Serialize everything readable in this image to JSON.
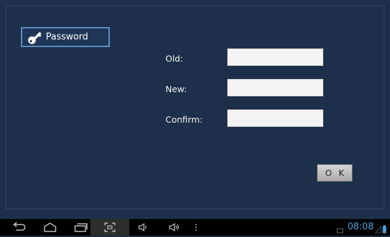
{
  "password_tab": {
    "label": "Password",
    "icon": "key-icon"
  },
  "form": {
    "old_label": "Old:",
    "new_label": "New:",
    "confirm_label": "Confirm:",
    "old_value": "",
    "new_value": "",
    "confirm_value": ""
  },
  "ok_label": "O K",
  "navbar": {
    "buttons": [
      "back-icon",
      "home-icon",
      "recent-apps-icon",
      "screenshot-icon",
      "volume-down-icon",
      "volume-up-icon",
      "menu-icon"
    ],
    "clock": "08:08"
  },
  "colors": {
    "background": "#1c2e49",
    "tab_border": "#5d8fc7",
    "clock": "#4aa3e0"
  }
}
